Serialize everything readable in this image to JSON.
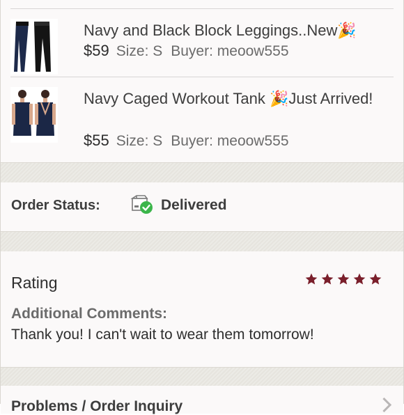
{
  "items": [
    {
      "title": "Navy and Black Block Leggings..New🎉",
      "price": "$59",
      "size": "Size: S",
      "buyer": "Buyer: meoow555",
      "thumb_icon": "leggings-photo"
    },
    {
      "title": "Navy Caged Workout Tank 🎉Just Arrived!",
      "price": "$55",
      "size": "Size: S",
      "buyer": "Buyer: meoow555",
      "thumb_icon": "tank-top-photo"
    }
  ],
  "order_status": {
    "label": "Order Status:",
    "value": "Delivered",
    "icon": "delivered-box-icon",
    "check_color": "#3bb54a"
  },
  "rating": {
    "label": "Rating",
    "stars": 5,
    "star_color": "#7a1f2b",
    "comments_label": "Additional Comments:",
    "comments_text": "Thank you! I can't wait to wear them tomorrow!"
  },
  "bottom_row": {
    "label": "Problems / Order Inquiry"
  }
}
